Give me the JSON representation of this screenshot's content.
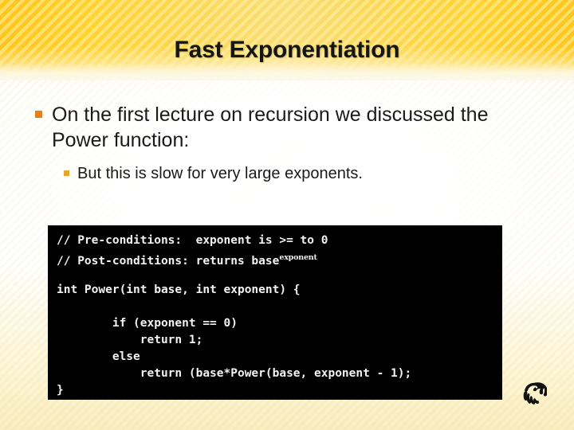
{
  "slide": {
    "title": "Fast Exponentiation",
    "accent_header_color": "#FDC61B",
    "accent_header_light_color": "#F9DF7A",
    "background_color": "#FFFFFF",
    "bullet_level1_color": "#E08214",
    "bullet_level2_color": "#E8A42C",
    "code_background_color": "#000000",
    "code_text_color": "#F2F2F2"
  },
  "bullets": [
    {
      "level": 1,
      "marker": "square-bullet-icon",
      "text": "On the first lecture on recursion we discussed the Power function:"
    },
    {
      "level": 2,
      "marker": "square-bullet-icon",
      "text": "But this is slow for very large exponents."
    }
  ],
  "code": {
    "lines": [
      {
        "id": "comment-pre",
        "text": "// Pre-conditions:  exponent is >= to 0"
      },
      {
        "id": "comment-post",
        "text": "// Post-conditions: returns base",
        "superscript": "exponent"
      },
      {
        "id": "blank-1",
        "text": ""
      },
      {
        "id": "signature",
        "text": "int Power(int base, int exponent) {"
      },
      {
        "id": "blank-2",
        "text": ""
      },
      {
        "id": "if-stmt",
        "text": "        if (exponent == 0)"
      },
      {
        "id": "return-one",
        "text": "            return 1;"
      },
      {
        "id": "else-stmt",
        "text": "        else"
      },
      {
        "id": "return-rec",
        "text": "            return (base*Power(base, exponent - 1);"
      },
      {
        "id": "close-brace",
        "text": "}"
      }
    ]
  },
  "logo": {
    "name": "ucf-pegasus-logo",
    "color": "#111111"
  }
}
